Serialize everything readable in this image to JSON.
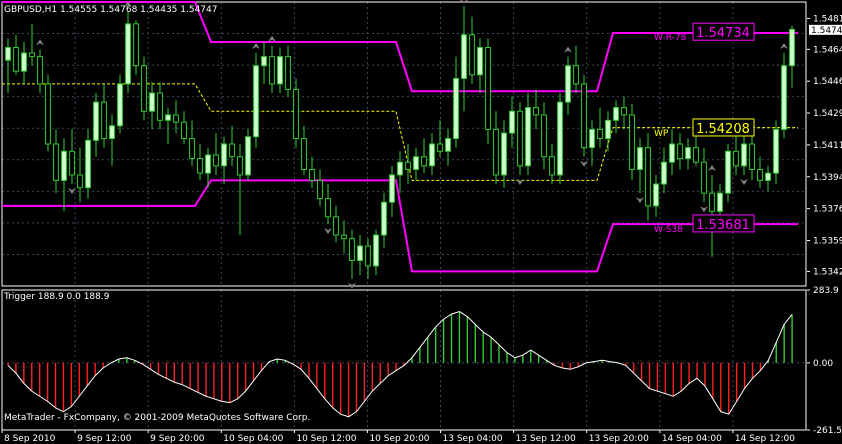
{
  "main_panel": {
    "title": "GBPUSD,H1  1.54555 1.54768 1.54435 1.54747",
    "price_ticks": [
      "1.54810",
      "1.54640",
      "1.54465",
      "1.54290",
      "1.54115",
      "1.53940",
      "1.53765",
      "1.53590",
      "1.53420"
    ],
    "current_price": "1.54747"
  },
  "labels": {
    "w_r_text": "W-R-78",
    "w_r_value": "1.54734",
    "wp_text": "WP",
    "wp_value": "1.54208",
    "w_s_text": "W-S38",
    "w_s_value": "1.53681"
  },
  "indicator_panel": {
    "title": "Trigger 188.9 0.0 188.9",
    "ticks": [
      "283.9",
      "0.00",
      "-261.5"
    ]
  },
  "watermark": "MetaTrader - FxCompany, © 2001-2009 MetaQuotes Software Corp.",
  "time_axis": [
    "8 Sep 2010",
    "9 Sep 12:00",
    "9 Sep 20:00",
    "10 Sep 04:00",
    "10 Sep 12:00",
    "10 Sep 20:00",
    "13 Sep 04:00",
    "13 Sep 12:00",
    "13 Sep 20:00",
    "14 Sep 04:00",
    "14 Sep 12:00"
  ],
  "colors": {
    "background": "#000000",
    "grid": "#3a4a5a",
    "bull_candle": "#ccffcc",
    "bear_candle": "#000000",
    "wick": "#33cc33",
    "weekly_band": "#ff00ff",
    "pivot": "#ffff00",
    "fractal": "#808080",
    "histogram_up": "#33cc33",
    "histogram_down": "#ff2020",
    "trigger_line": "#ffffff"
  },
  "chart_data": {
    "type": "candlestick",
    "symbol": "GBPUSD",
    "timeframe": "H1",
    "y_range": [
      1.5334,
      1.549
    ],
    "candles": [
      [
        1.5458,
        1.547,
        1.544,
        1.5465
      ],
      [
        1.5465,
        1.5472,
        1.545,
        1.5452
      ],
      [
        1.5452,
        1.5468,
        1.5445,
        1.5462
      ],
      [
        1.5462,
        1.5478,
        1.5455,
        1.546
      ],
      [
        1.546,
        1.5464,
        1.544,
        1.5445
      ],
      [
        1.5445,
        1.545,
        1.5408,
        1.5412
      ],
      [
        1.5412,
        1.542,
        1.5385,
        1.5392
      ],
      [
        1.5392,
        1.5415,
        1.5375,
        1.5408
      ],
      [
        1.5408,
        1.542,
        1.539,
        1.5395
      ],
      [
        1.5395,
        1.541,
        1.538,
        1.5388
      ],
      [
        1.5388,
        1.542,
        1.5382,
        1.5414
      ],
      [
        1.5414,
        1.544,
        1.5405,
        1.5435
      ],
      [
        1.5435,
        1.5445,
        1.541,
        1.5415
      ],
      [
        1.5415,
        1.5428,
        1.54,
        1.5422
      ],
      [
        1.5422,
        1.545,
        1.5418,
        1.5445
      ],
      [
        1.5445,
        1.5485,
        1.544,
        1.5478
      ],
      [
        1.5478,
        1.548,
        1.545,
        1.5455
      ],
      [
        1.5455,
        1.546,
        1.5425,
        1.543
      ],
      [
        1.543,
        1.5446,
        1.542,
        1.544
      ],
      [
        1.544,
        1.5446,
        1.542,
        1.5425
      ],
      [
        1.5425,
        1.5432,
        1.5412,
        1.5428
      ],
      [
        1.5428,
        1.5436,
        1.5418,
        1.5424
      ],
      [
        1.5424,
        1.543,
        1.5412,
        1.5415
      ],
      [
        1.5415,
        1.5425,
        1.54,
        1.5404
      ],
      [
        1.5404,
        1.5412,
        1.5392,
        1.5396
      ],
      [
        1.5396,
        1.541,
        1.5388,
        1.5406
      ],
      [
        1.5406,
        1.5418,
        1.5395,
        1.54
      ],
      [
        1.54,
        1.5416,
        1.539,
        1.5412
      ],
      [
        1.5412,
        1.5422,
        1.54,
        1.5405
      ],
      [
        1.5405,
        1.5412,
        1.5362,
        1.5395
      ],
      [
        1.5395,
        1.542,
        1.5392,
        1.5416
      ],
      [
        1.5416,
        1.5462,
        1.541,
        1.5455
      ],
      [
        1.5455,
        1.5468,
        1.5445,
        1.546
      ],
      [
        1.546,
        1.5466,
        1.544,
        1.5445
      ],
      [
        1.5445,
        1.5465,
        1.544,
        1.546
      ],
      [
        1.546,
        1.5466,
        1.5438,
        1.5442
      ],
      [
        1.5442,
        1.5448,
        1.541,
        1.5415
      ],
      [
        1.5415,
        1.5422,
        1.5395,
        1.5398
      ],
      [
        1.5398,
        1.5405,
        1.5388,
        1.5392
      ],
      [
        1.5392,
        1.5398,
        1.5378,
        1.5382
      ],
      [
        1.5382,
        1.539,
        1.5368,
        1.5372
      ],
      [
        1.5372,
        1.5378,
        1.5358,
        1.5362
      ],
      [
        1.5362,
        1.537,
        1.5352,
        1.536
      ],
      [
        1.536,
        1.5365,
        1.5338,
        1.5348
      ],
      [
        1.5348,
        1.5362,
        1.534,
        1.5356
      ],
      [
        1.5356,
        1.536,
        1.5338,
        1.5345
      ],
      [
        1.5345,
        1.5365,
        1.534,
        1.5362
      ],
      [
        1.5362,
        1.5385,
        1.5355,
        1.538
      ],
      [
        1.538,
        1.54,
        1.5372,
        1.5395
      ],
      [
        1.5395,
        1.5408,
        1.5385,
        1.5402
      ],
      [
        1.5402,
        1.5412,
        1.539,
        1.5398
      ],
      [
        1.5398,
        1.541,
        1.5392,
        1.5405
      ],
      [
        1.5405,
        1.5415,
        1.5396,
        1.54
      ],
      [
        1.54,
        1.5418,
        1.5395,
        1.5412
      ],
      [
        1.5412,
        1.5425,
        1.5405,
        1.5408
      ],
      [
        1.5408,
        1.542,
        1.54,
        1.5415
      ],
      [
        1.5415,
        1.546,
        1.541,
        1.5448
      ],
      [
        1.5448,
        1.5488,
        1.543,
        1.5472
      ],
      [
        1.5472,
        1.5482,
        1.5445,
        1.545
      ],
      [
        1.545,
        1.547,
        1.544,
        1.5465
      ],
      [
        1.5465,
        1.547,
        1.5412,
        1.542
      ],
      [
        1.542,
        1.543,
        1.539,
        1.5395
      ],
      [
        1.5395,
        1.5425,
        1.5388,
        1.5418
      ],
      [
        1.5418,
        1.5438,
        1.541,
        1.543
      ],
      [
        1.543,
        1.5435,
        1.5395,
        1.54
      ],
      [
        1.54,
        1.544,
        1.5395,
        1.5432
      ],
      [
        1.5432,
        1.5442,
        1.542,
        1.5428
      ],
      [
        1.5428,
        1.5435,
        1.5398,
        1.5405
      ],
      [
        1.5405,
        1.5412,
        1.539,
        1.5395
      ],
      [
        1.5395,
        1.544,
        1.539,
        1.5435
      ],
      [
        1.5435,
        1.546,
        1.5428,
        1.5455
      ],
      [
        1.5455,
        1.5466,
        1.544,
        1.5445
      ],
      [
        1.5445,
        1.545,
        1.5405,
        1.541
      ],
      [
        1.541,
        1.5425,
        1.54,
        1.542
      ],
      [
        1.542,
        1.5432,
        1.541,
        1.5415
      ],
      [
        1.5415,
        1.543,
        1.5408,
        1.5425
      ],
      [
        1.5425,
        1.5436,
        1.5418,
        1.5432
      ],
      [
        1.5432,
        1.5438,
        1.542,
        1.5428
      ],
      [
        1.5428,
        1.5434,
        1.5392,
        1.5398
      ],
      [
        1.5398,
        1.5415,
        1.5385,
        1.541
      ],
      [
        1.541,
        1.5418,
        1.537,
        1.5378
      ],
      [
        1.5378,
        1.5395,
        1.5372,
        1.539
      ],
      [
        1.539,
        1.541,
        1.5385,
        1.5402
      ],
      [
        1.5402,
        1.542,
        1.5395,
        1.5412
      ],
      [
        1.5412,
        1.5418,
        1.5398,
        1.5404
      ],
      [
        1.5404,
        1.5415,
        1.5398,
        1.541
      ],
      [
        1.541,
        1.5422,
        1.54,
        1.5402
      ],
      [
        1.5402,
        1.541,
        1.538,
        1.5385
      ],
      [
        1.5385,
        1.5395,
        1.535,
        1.5375
      ],
      [
        1.5375,
        1.539,
        1.5368,
        1.5385
      ],
      [
        1.5385,
        1.5412,
        1.538,
        1.5408
      ],
      [
        1.5408,
        1.5418,
        1.5395,
        1.54
      ],
      [
        1.54,
        1.5418,
        1.5395,
        1.5412
      ],
      [
        1.5412,
        1.542,
        1.5392,
        1.5398
      ],
      [
        1.5398,
        1.5405,
        1.5388,
        1.5392
      ],
      [
        1.5392,
        1.54,
        1.5386,
        1.5396
      ],
      [
        1.5396,
        1.5425,
        1.539,
        1.542
      ],
      [
        1.542,
        1.5462,
        1.5415,
        1.5455
      ],
      [
        1.5455,
        1.5477,
        1.5443,
        1.5475
      ]
    ],
    "weekly_resistance": [
      1.549,
      1.549,
      1.5468,
      1.5468,
      1.5441,
      1.5441,
      1.5473,
      1.5473
    ],
    "weekly_pivot": [
      1.5445,
      1.5445,
      1.543,
      1.543,
      1.5392,
      1.5392,
      1.5421,
      1.5421
    ],
    "weekly_support": [
      1.5378,
      1.5378,
      1.5392,
      1.5392,
      1.5342,
      1.5342,
      1.5368,
      1.5368
    ],
    "fractals_up": [
      4,
      15,
      31,
      33,
      57,
      70,
      88,
      97
    ],
    "fractals_down": [
      8,
      40,
      43,
      64,
      72,
      79,
      87,
      92
    ],
    "indicator": {
      "name": "Trigger",
      "y_range": [
        -261.5,
        283.9
      ],
      "values": [
        -10,
        -40,
        -80,
        -110,
        -130,
        -150,
        -175,
        -190,
        -170,
        -130,
        -90,
        -50,
        -20,
        0,
        15,
        20,
        10,
        -5,
        -25,
        -45,
        -60,
        -75,
        -85,
        -100,
        -115,
        -130,
        -140,
        -150,
        -155,
        -140,
        -110,
        -70,
        -30,
        5,
        15,
        10,
        -5,
        -25,
        -60,
        -100,
        -140,
        -175,
        -200,
        -210,
        -190,
        -150,
        -110,
        -80,
        -50,
        -30,
        -10,
        20,
        60,
        100,
        140,
        170,
        190,
        200,
        180,
        150,
        120,
        100,
        70,
        40,
        20,
        30,
        50,
        30,
        10,
        -10,
        -20,
        -25,
        -15,
        0,
        5,
        10,
        5,
        0,
        -10,
        -40,
        -70,
        -100,
        -110,
        -120,
        -130,
        -110,
        -80,
        -60,
        -90,
        -140,
        -190,
        -200,
        -150,
        -100,
        -60,
        -30,
        10,
        80,
        150,
        188.9
      ]
    }
  }
}
